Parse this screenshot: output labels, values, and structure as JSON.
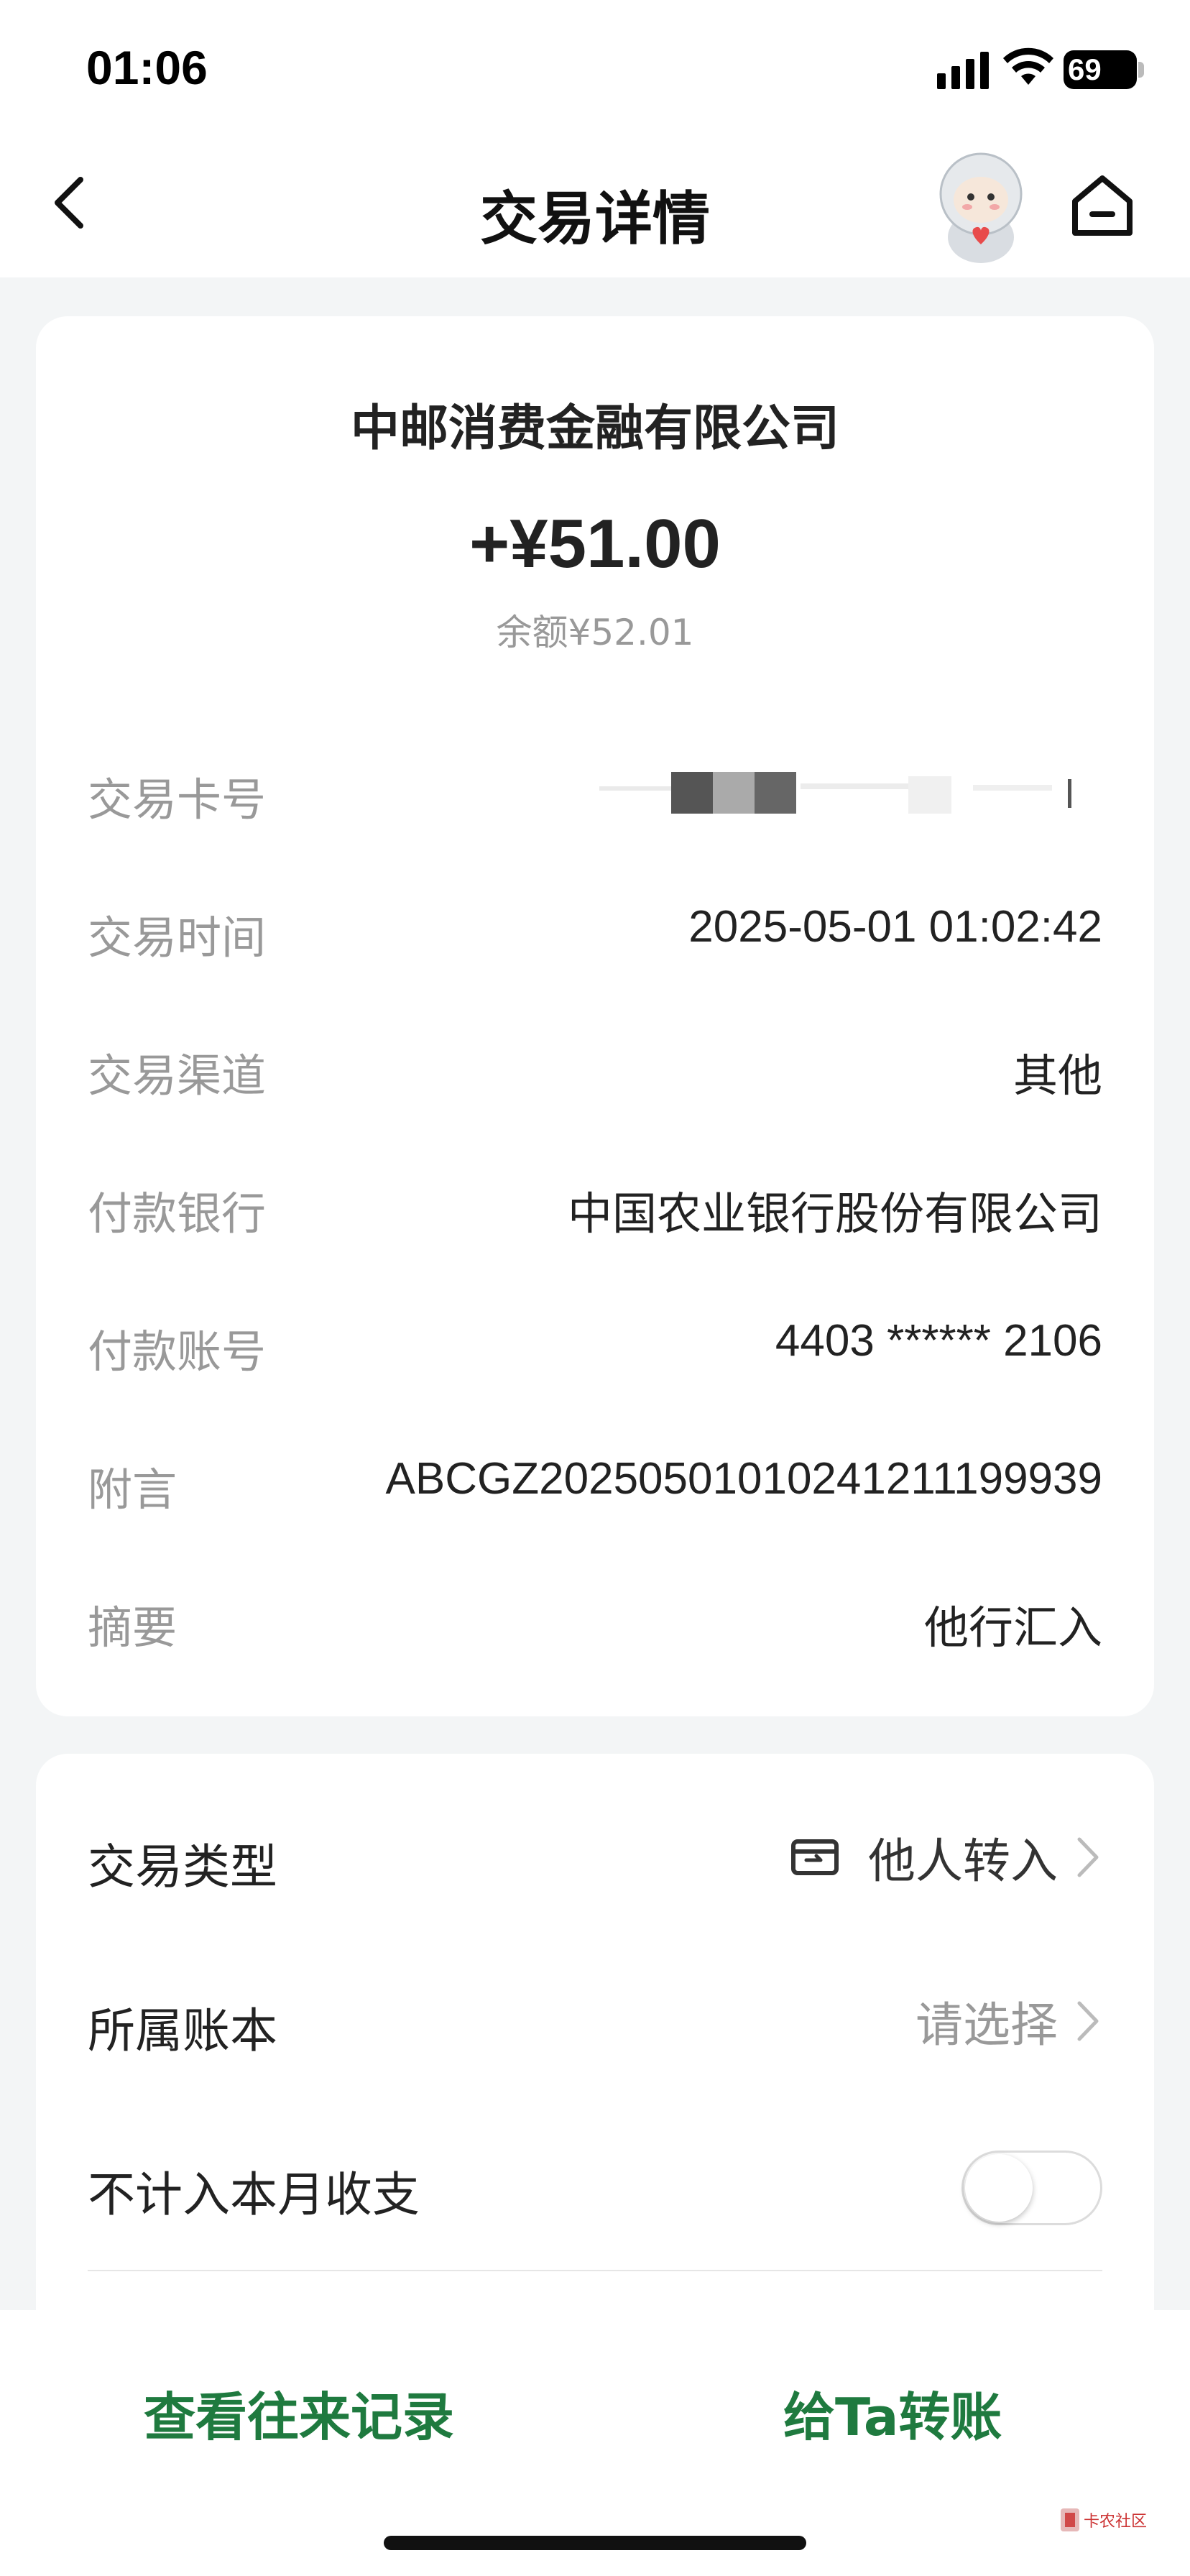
{
  "status_bar": {
    "time": "01:06",
    "battery": "69"
  },
  "nav": {
    "title": "交易详情"
  },
  "summary": {
    "payee": "中邮消费金融有限公司",
    "amount": "+¥51.00",
    "balance": "余额¥52.01"
  },
  "details": [
    {
      "label": "交易卡号",
      "value": ""
    },
    {
      "label": "交易时间",
      "value": "2025-05-01 01:02:42"
    },
    {
      "label": "交易渠道",
      "value": "其他"
    },
    {
      "label": "付款银行",
      "value": "中国农业银行股份有限公司"
    },
    {
      "label": "付款账号",
      "value": "4403 ****** 2106"
    },
    {
      "label": "附言",
      "value": "ABCGZ20250501010241211199939"
    },
    {
      "label": "摘要",
      "value": "他行汇入"
    }
  ],
  "options": {
    "type": {
      "label": "交易类型",
      "value": "他人转入",
      "icon": "transfer-in-icon"
    },
    "book": {
      "label": "所属账本",
      "value": "请选择"
    },
    "exclude": {
      "label": "不计入本月收支",
      "enabled": false
    }
  },
  "actions": {
    "history": "查看往来记录",
    "transfer": "给Ta转账"
  },
  "watermark": {
    "text": "卡农社区"
  },
  "colors": {
    "accent": "#1f7a3f",
    "background": "#f3f5f6"
  }
}
